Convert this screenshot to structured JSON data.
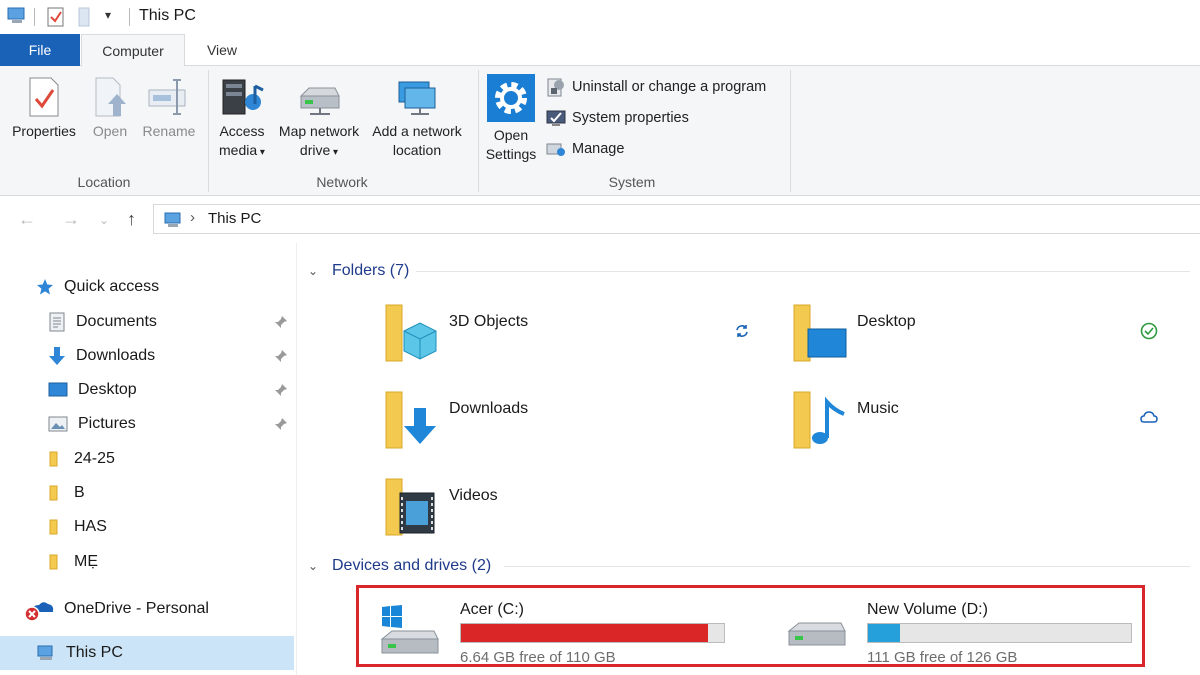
{
  "window": {
    "title": "This PC"
  },
  "tabs": {
    "file": "File",
    "computer": "Computer",
    "view": "View"
  },
  "ribbon": {
    "location": {
      "label": "Location",
      "properties": "Properties",
      "open": "Open",
      "rename": "Rename"
    },
    "network": {
      "label": "Network",
      "access_media_l1": "Access",
      "access_media_l2": "media",
      "map_drive_l1": "Map network",
      "map_drive_l2": "drive",
      "add_location_l1": "Add a network",
      "add_location_l2": "location"
    },
    "system": {
      "label": "System",
      "open_settings_l1": "Open",
      "open_settings_l2": "Settings",
      "uninstall": "Uninstall or change a program",
      "system_properties": "System properties",
      "manage": "Manage"
    }
  },
  "address": {
    "path": "This PC"
  },
  "sidebar": {
    "quick_access": "Quick access",
    "items": [
      {
        "label": "Documents",
        "pinned": true
      },
      {
        "label": "Downloads",
        "pinned": true
      },
      {
        "label": "Desktop",
        "pinned": true
      },
      {
        "label": "Pictures",
        "pinned": true
      },
      {
        "label": "24-25",
        "pinned": false
      },
      {
        "label": "B",
        "pinned": false
      },
      {
        "label": "HAS",
        "pinned": false
      },
      {
        "label": "MẸ",
        "pinned": false
      }
    ],
    "onedrive": "OneDrive - Personal",
    "this_pc": "This PC"
  },
  "folders": {
    "heading": "Folders (7)",
    "items": [
      {
        "name": "3D Objects",
        "status": "sync-icon"
      },
      {
        "name": "Desktop",
        "status": "check-icon"
      },
      {
        "name": "Downloads",
        "status": ""
      },
      {
        "name": "Music",
        "status": "cloud-icon"
      },
      {
        "name": "Videos",
        "status": ""
      }
    ]
  },
  "drives": {
    "heading": "Devices and drives (2)",
    "items": [
      {
        "name": "Acer (C:)",
        "free_text": "6.64 GB free of 110 GB",
        "used_fraction": 0.94,
        "bar_color": "#da2626"
      },
      {
        "name": "New Volume (D:)",
        "free_text": "111 GB free of 126 GB",
        "used_fraction": 0.12,
        "bar_color": "#26a0da"
      }
    ]
  },
  "colors": {
    "accent": "#1a62b8",
    "selection": "#cce4f7",
    "highlight": "#d9262c"
  }
}
